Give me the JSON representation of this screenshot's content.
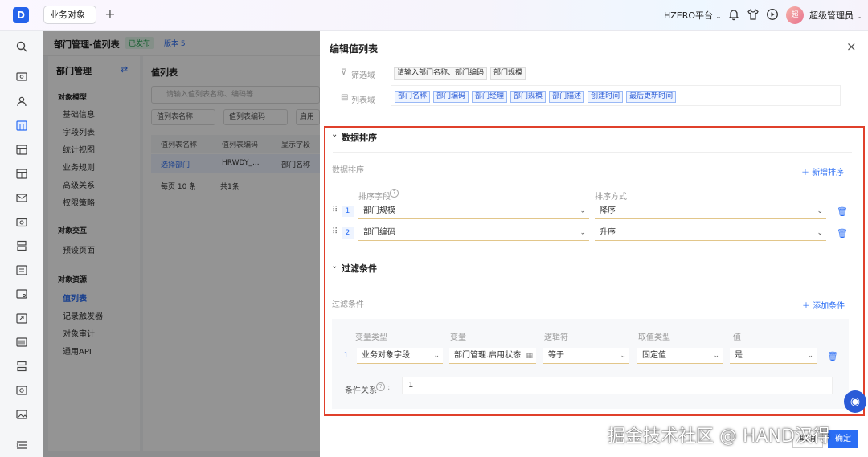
{
  "topbar": {
    "logo": "D",
    "tab_label": "业务对象",
    "platform": "HZERO平台",
    "avatar_text": "超",
    "username": "超级管理员"
  },
  "underlay": {
    "title": "部门管理-值列表",
    "status": "已发布",
    "version": "版本 5",
    "side_title": "部门管理",
    "group1": "对象模型",
    "group1_items": [
      "基础信息",
      "字段列表",
      "统计视图",
      "业务规则",
      "高级关系",
      "权限策略"
    ],
    "group2": "对象交互",
    "group2_items": [
      "预设页面"
    ],
    "group3": "对象资源",
    "group3_items": [
      "值列表",
      "记录触发器",
      "对象审计",
      "通用API"
    ],
    "main_title": "值列表",
    "search_placeholder": "请输入值列表名称、编码等",
    "filter1": "值列表名称",
    "filter2": "值列表编码",
    "filter3": "启用",
    "col1": "值列表名称",
    "col2": "值列表编码",
    "col3": "显示字段",
    "row_name": "选择部门",
    "row_code": "HRWDY_...",
    "row_display": "部门名称",
    "page_size": "每页 10 条",
    "total": "共1条"
  },
  "drawer": {
    "title": "编辑值列表",
    "filter_field_label": "筛选域",
    "filter_field_tags": [
      "请输入部门名称、部门编码",
      "部门规模"
    ],
    "list_field_label": "列表域",
    "list_field_tags": [
      "部门名称",
      "部门编码",
      "部门经理",
      "部门规模",
      "部门描述",
      "创建时间",
      "最后更新时间"
    ],
    "sort_section": "数据排序",
    "sort_sub": "数据排序",
    "add_sort": "新增排序",
    "sort_field_header": "排序字段",
    "sort_method_header": "排序方式",
    "sort_rows": [
      {
        "index": "1",
        "field": "部门规模",
        "method": "降序"
      },
      {
        "index": "2",
        "field": "部门编码",
        "method": "升序"
      }
    ],
    "filter_section": "过滤条件",
    "filter_sub": "过滤条件",
    "add_condition": "添加条件",
    "cond_headers": [
      "变量类型",
      "变量",
      "逻辑符",
      "取值类型",
      "值"
    ],
    "cond_row": {
      "index": "1",
      "var_type": "业务对象字段",
      "var": "部门管理.启用状态",
      "op": "等于",
      "value_type": "固定值",
      "value": "是"
    },
    "relation_label": "条件关系",
    "relation_value": "1",
    "cancel": "取消",
    "confirm": "确定"
  },
  "watermark": "掘金技术社区 @ HAND汉得",
  "colors": {
    "primary": "#2a6df4",
    "highlight_border": "#e0402b",
    "underline": "#e2c68a"
  }
}
